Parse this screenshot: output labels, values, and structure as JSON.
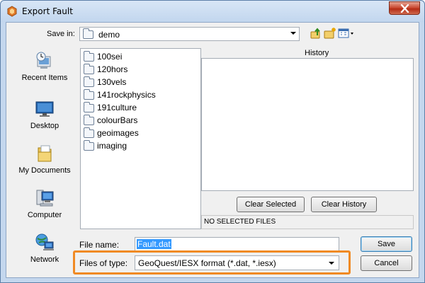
{
  "window": {
    "title": "Export Fault",
    "accent_color": "#f08a24"
  },
  "save_in": {
    "label": "Save in:",
    "value": "demo",
    "icon": "folder-icon"
  },
  "toolbar": {
    "up_icon": "up-one-level-icon",
    "new_folder_icon": "new-folder-icon",
    "view_menu_icon": "view-menu-icon"
  },
  "places": [
    {
      "label": "Recent Items",
      "icon": "recent-items-icon"
    },
    {
      "label": "Desktop",
      "icon": "desktop-icon"
    },
    {
      "label": "My Documents",
      "icon": "my-documents-icon"
    },
    {
      "label": "Computer",
      "icon": "computer-icon"
    },
    {
      "label": "Network",
      "icon": "network-icon"
    }
  ],
  "files": [
    "100sei",
    "120hors",
    "130vels",
    "141rockphysics",
    "191culture",
    "colourBars",
    "geoimages",
    "imaging"
  ],
  "history": {
    "label": "History",
    "clear_selected": "Clear Selected",
    "clear_history": "Clear History",
    "status": "NO SELECTED FILES"
  },
  "file_name": {
    "label": "File name:",
    "value": "Fault.dat"
  },
  "files_of_type": {
    "label": "Files of type:",
    "value": "GeoQuest/IESX format (*.dat, *.iesx)"
  },
  "buttons": {
    "save": "Save",
    "cancel": "Cancel"
  }
}
